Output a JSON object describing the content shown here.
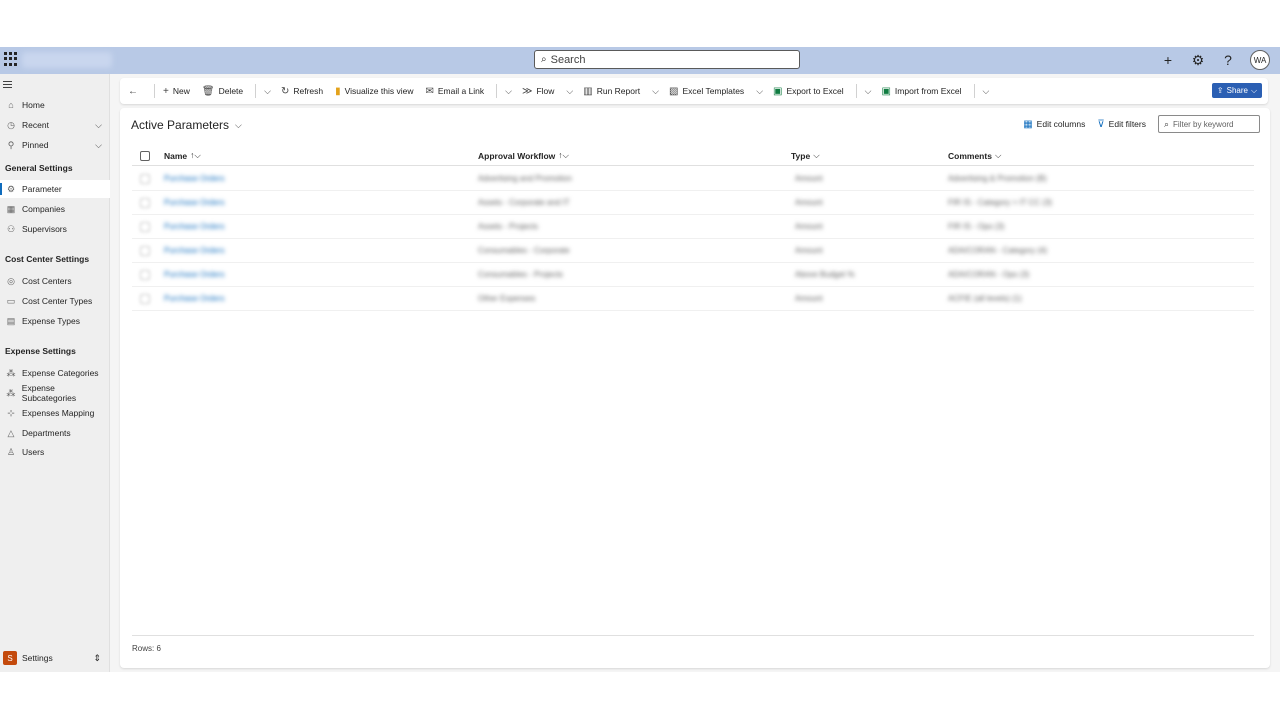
{
  "topbar": {
    "search_placeholder": "Search",
    "avatar_initials": "WA"
  },
  "sidebar": {
    "top_items": [
      {
        "label": "Home"
      },
      {
        "label": "Recent"
      },
      {
        "label": "Pinned"
      }
    ],
    "groups": [
      {
        "title": "General Settings",
        "items": [
          "Parameter",
          "Companies",
          "Supervisors"
        ]
      },
      {
        "title": "Cost Center Settings",
        "items": [
          "Cost Centers",
          "Cost Center Types",
          "Expense Types"
        ]
      },
      {
        "title": "Expense Settings",
        "items": [
          "Expense Categories",
          "Expense Subcategories",
          "Expenses Mapping",
          "Departments",
          "Users"
        ]
      }
    ],
    "selected": "Parameter",
    "area": {
      "badge": "S",
      "label": "Settings"
    }
  },
  "commands": {
    "new": "New",
    "delete": "Delete",
    "refresh": "Refresh",
    "visualize": "Visualize this view",
    "email_link": "Email a Link",
    "flow": "Flow",
    "run_report": "Run Report",
    "excel_templates": "Excel Templates",
    "export_excel": "Export to Excel",
    "import_excel": "Import from Excel",
    "share": "Share"
  },
  "view": {
    "title": "Active Parameters",
    "edit_columns": "Edit columns",
    "edit_filters": "Edit filters",
    "filter_placeholder": "Filter by keyword"
  },
  "grid": {
    "columns": [
      "Name",
      "Approval Workflow",
      "Type",
      "Comments"
    ],
    "rows": [
      [
        "Purchase Orders",
        "Advertising and Promotion",
        "Amount",
        "Advertising & Promotion (B)"
      ],
      [
        "Purchase Orders",
        "Assets - Corporate and IT",
        "Amount",
        "FIR IS - Category > IT CC (3)"
      ],
      [
        "Purchase Orders",
        "Assets - Projects",
        "Amount",
        "FIR IS - Ops (3)"
      ],
      [
        "Purchase Orders",
        "Consumables - Corporate",
        "Amount",
        "ADA/CORAN - Category (4)"
      ],
      [
        "Purchase Orders",
        "Consumables - Projects",
        "Above Budget %",
        "ADA/CORAN - Ops (3)"
      ],
      [
        "Purchase Orders",
        "Other Expenses",
        "Amount",
        "ACFIE (all levels) (1)"
      ]
    ],
    "rows_label": "Rows: 6"
  }
}
